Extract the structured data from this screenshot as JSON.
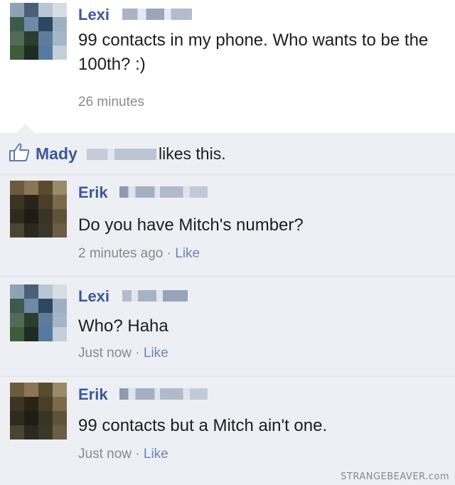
{
  "post": {
    "author": "Lexi",
    "text": "99 contacts in my phone. Who wants to be the 100th? :)",
    "time": "26 minutes"
  },
  "likes": {
    "name": "Mady",
    "text": "likes this.",
    "icon": "thumbs-up-icon"
  },
  "comments": [
    {
      "author": "Erik",
      "text": "Do you have Mitch's number?",
      "time": "2 minutes ago",
      "separator": " · ",
      "like": "Like"
    },
    {
      "author": "Lexi",
      "text": "Who? Haha",
      "time": "Just now",
      "separator": " · ",
      "like": "Like"
    },
    {
      "author": "Erik",
      "text": "99 contacts but a Mitch ain't one.",
      "time": "Just now",
      "separator": " · ",
      "like": "Like"
    }
  ],
  "watermark": "STRANGEBEAVER.com",
  "colors": {
    "link": "#3b5998",
    "feedback_bg": "#edeff4",
    "meta": "#8a8a8a"
  }
}
